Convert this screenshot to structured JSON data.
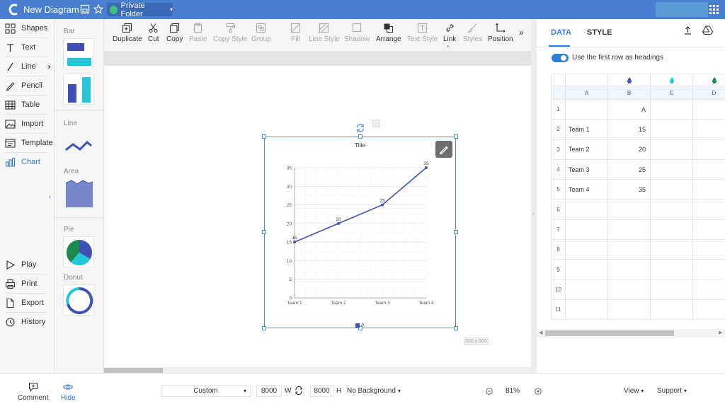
{
  "topbar": {
    "title": "New Diagram",
    "folder_label": "Private Folder"
  },
  "sidebar": {
    "items": [
      {
        "label": "Shapes",
        "icon": "shapes-icon"
      },
      {
        "label": "Text",
        "icon": "text-icon"
      },
      {
        "label": "Line",
        "icon": "line-icon"
      },
      {
        "label": "Pencil",
        "icon": "pencil-icon"
      },
      {
        "label": "Table",
        "icon": "table-icon"
      },
      {
        "label": "Import",
        "icon": "image-icon"
      },
      {
        "label": "Template",
        "icon": "template-icon"
      },
      {
        "label": "Chart",
        "icon": "chart-icon"
      },
      {
        "label": "Play",
        "icon": "play-icon"
      },
      {
        "label": "Print",
        "icon": "print-icon"
      },
      {
        "label": "Export",
        "icon": "export-icon"
      },
      {
        "label": "History",
        "icon": "history-icon"
      }
    ]
  },
  "panel": {
    "categories": [
      "Bar",
      "Line",
      "Area",
      "Pie",
      "Donut"
    ]
  },
  "toolbar": {
    "buttons": [
      "Duplicate",
      "Cut",
      "Copy",
      "Paste",
      "Copy Style",
      "Group",
      "Fill",
      "Line Style",
      "Shadow",
      "Arrange",
      "Text Style",
      "Link",
      "Styles",
      "Position"
    ],
    "more": "»"
  },
  "canvas": {
    "size_tag": "500 x 500"
  },
  "chart_data": {
    "type": "line",
    "title": "Title",
    "categories": [
      "Team 1",
      "Team 2",
      "Team 3",
      "Team 4"
    ],
    "series": [
      {
        "name": "A",
        "values": [
          15,
          20,
          25,
          35
        ],
        "color": "#3f51b5"
      }
    ],
    "ylim": [
      0,
      35
    ],
    "yticks": [
      0,
      5,
      10,
      15,
      20,
      25,
      30,
      35
    ],
    "grid": true,
    "legend": "bottom"
  },
  "data_panel": {
    "tabs": [
      "DATA",
      "STYLE"
    ],
    "toggle_label": "Use the first row as headings",
    "column_colors": [
      "#3f51b5",
      "#26c6da",
      "#1b8a4e"
    ],
    "column_headers": [
      "A",
      "B",
      "C",
      "D"
    ],
    "rows": [
      {
        "num": "1",
        "a": "",
        "b": "A"
      },
      {
        "num": "2",
        "a": "Team 1",
        "b": "15"
      },
      {
        "num": "3",
        "a": "Team 2",
        "b": "20"
      },
      {
        "num": "4",
        "a": "Team 3",
        "b": "25"
      },
      {
        "num": "5",
        "a": "Team 4",
        "b": "35"
      },
      {
        "num": "6",
        "a": "",
        "b": ""
      },
      {
        "num": "7",
        "a": "",
        "b": ""
      },
      {
        "num": "8",
        "a": "",
        "b": ""
      },
      {
        "num": "9",
        "a": "",
        "b": ""
      },
      {
        "num": "10",
        "a": "",
        "b": ""
      },
      {
        "num": "11",
        "a": "",
        "b": ""
      }
    ]
  },
  "bottombar": {
    "comment": "Comment",
    "hide": "Hide",
    "page_size": "Custom",
    "width": "8000",
    "width_unit": "W",
    "height": "8000",
    "height_unit": "H",
    "background": "No Background",
    "zoom": "81%",
    "view": "View",
    "support": "Support"
  }
}
